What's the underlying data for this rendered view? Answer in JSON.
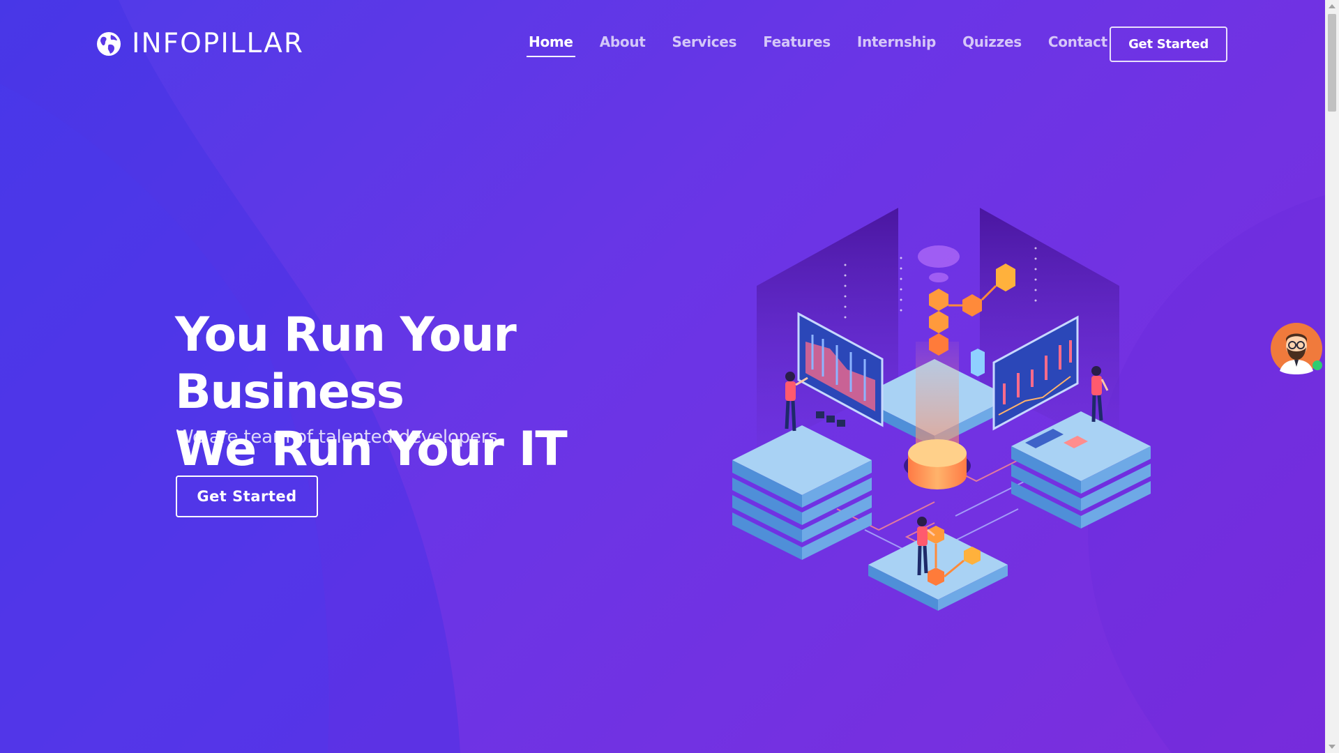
{
  "brand": {
    "name": "INFOPILLAR",
    "icon": "globe-icon"
  },
  "nav": {
    "items": [
      {
        "label": "Home",
        "active": true
      },
      {
        "label": "About",
        "active": false
      },
      {
        "label": "Services",
        "active": false
      },
      {
        "label": "Features",
        "active": false
      },
      {
        "label": "Internship",
        "active": false
      },
      {
        "label": "Quizzes",
        "active": false
      },
      {
        "label": "Contact",
        "active": false
      }
    ],
    "cta_label": "Get Started"
  },
  "hero": {
    "title_line1": "You Run Your Business",
    "title_line2": "We Run Your IT",
    "subtitle": "We are team of talented developers",
    "cta_label": "Get Started"
  },
  "chat": {
    "icon": "support-avatar-icon",
    "status": "online"
  },
  "colors": {
    "background_start": "#4f3be8",
    "background_end": "#7d2ddc",
    "accent_orange": "#ff9b3d",
    "platform_blue": "#8fc3ee",
    "online_green": "#2ecc71"
  }
}
